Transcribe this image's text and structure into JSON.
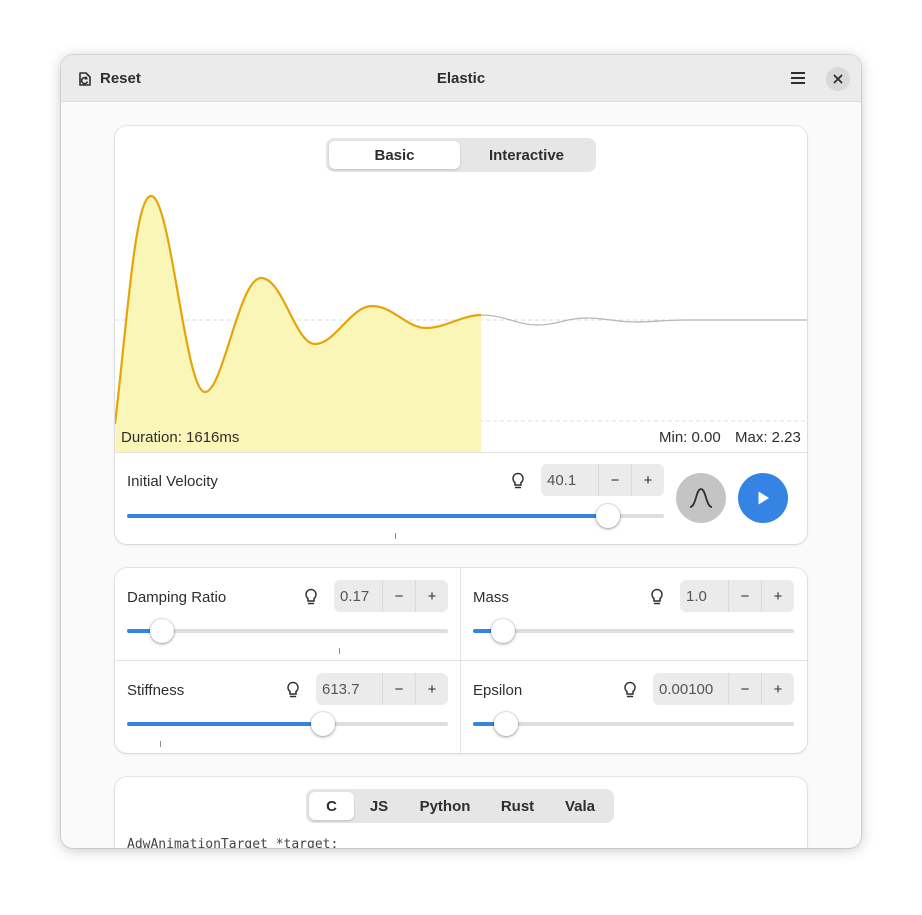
{
  "header": {
    "title": "Elastic",
    "reset_label": "Reset",
    "reset_icon": "reset-icon",
    "menu_icon": "hamburger-icon",
    "close_icon": "close-icon"
  },
  "mode_tabs": [
    {
      "label": "Basic",
      "active": true
    },
    {
      "label": "Interactive",
      "active": false
    }
  ],
  "graph": {
    "duration_label": "Duration: 1616ms",
    "min_label": "Min: 0.00",
    "max_label": "Max: 2.23",
    "colors": {
      "curve": "#e5a50a",
      "fill": "#f9f6b8",
      "tail": "#b5b5b5"
    }
  },
  "initial_velocity": {
    "label": "Initial Velocity",
    "value": "40.1",
    "decrement": "−",
    "increment": "+",
    "slider_fraction": 0.9,
    "hint_icon": "lightbulb-icon"
  },
  "actions": {
    "curve_icon": "curve-icon",
    "play_icon": "play-icon",
    "accent": "#3584e4"
  },
  "params": {
    "damping_ratio": {
      "label": "Damping Ratio",
      "value": "0.17",
      "slider_fraction": 0.11
    },
    "mass": {
      "label": "Mass",
      "value": "1.0",
      "slider_fraction": 0.09
    },
    "stiffness": {
      "label": "Stiffness",
      "value": "613.7",
      "slider_fraction": 0.61
    },
    "epsilon": {
      "label": "Epsilon",
      "value": "0.00100",
      "slider_fraction": 0.1
    },
    "decrement": "−",
    "increment": "+"
  },
  "lang_tabs": [
    {
      "label": "C",
      "active": true
    },
    {
      "label": "JS",
      "active": false
    },
    {
      "label": "Python",
      "active": false
    },
    {
      "label": "Rust",
      "active": false
    },
    {
      "label": "Vala",
      "active": false
    }
  ],
  "code": {
    "first_line": "AdwAnimationTarget *target;"
  }
}
